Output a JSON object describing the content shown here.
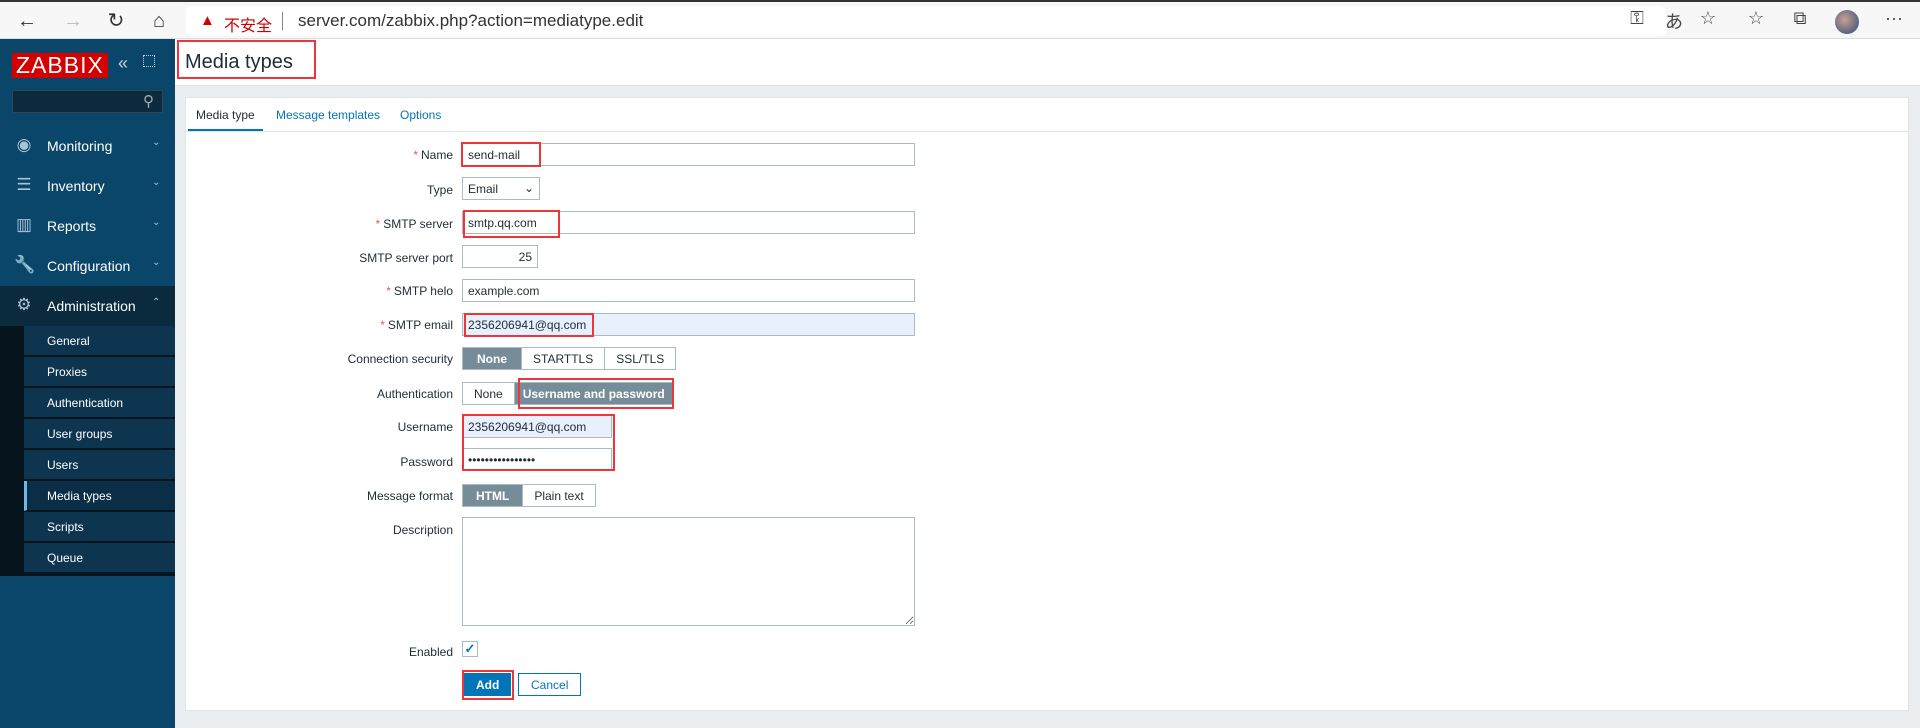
{
  "browser": {
    "security_label": "不安全",
    "url": "server.com/zabbix.php?action=mediatype.edit",
    "icons": [
      "back-icon",
      "forward-icon",
      "refresh-icon",
      "home-icon",
      "key-icon",
      "translate-icon",
      "favorite-add-icon",
      "favorites-icon",
      "collections-icon",
      "profile-avatar",
      "more-icon"
    ]
  },
  "sidebar": {
    "logo": "ZABBIX",
    "menu": [
      {
        "label": "Monitoring",
        "icon": "eye-icon"
      },
      {
        "label": "Inventory",
        "icon": "list-icon"
      },
      {
        "label": "Reports",
        "icon": "chart-icon"
      },
      {
        "label": "Configuration",
        "icon": "wrench-icon"
      },
      {
        "label": "Administration",
        "icon": "gear-icon"
      }
    ],
    "submenu": [
      "General",
      "Proxies",
      "Authentication",
      "User groups",
      "Users",
      "Media types",
      "Scripts",
      "Queue"
    ],
    "active_submenu": "Media types"
  },
  "header": {
    "title": "Media types"
  },
  "tabs": [
    "Media type",
    "Message templates",
    "Options"
  ],
  "form": {
    "name": {
      "label": "Name",
      "value": "send-mail"
    },
    "type": {
      "label": "Type",
      "value": "Email"
    },
    "smtp_server": {
      "label": "SMTP server",
      "value": "smtp.qq.com"
    },
    "smtp_port": {
      "label": "SMTP server port",
      "value": "25"
    },
    "smtp_helo": {
      "label": "SMTP helo",
      "value": "example.com"
    },
    "smtp_email": {
      "label": "SMTP email",
      "value": "2356206941@qq.com"
    },
    "connection_security": {
      "label": "Connection security",
      "options": [
        "None",
        "STARTTLS",
        "SSL/TLS"
      ],
      "selected": "None"
    },
    "authentication": {
      "label": "Authentication",
      "options": [
        "None",
        "Username and password"
      ],
      "selected": "Username and password"
    },
    "username": {
      "label": "Username",
      "value": "2356206941@qq.com"
    },
    "password": {
      "label": "Password",
      "value": "••••••••••••••••"
    },
    "message_format": {
      "label": "Message format",
      "options": [
        "HTML",
        "Plain text"
      ],
      "selected": "HTML"
    },
    "description": {
      "label": "Description",
      "value": ""
    },
    "enabled": {
      "label": "Enabled",
      "checked": true
    },
    "add_label": "Add",
    "cancel_label": "Cancel"
  },
  "colors": {
    "sidebar": "#0a466a",
    "accent": "#0275b8",
    "highlight_box": "#f0353a",
    "logo": "#d40000"
  }
}
